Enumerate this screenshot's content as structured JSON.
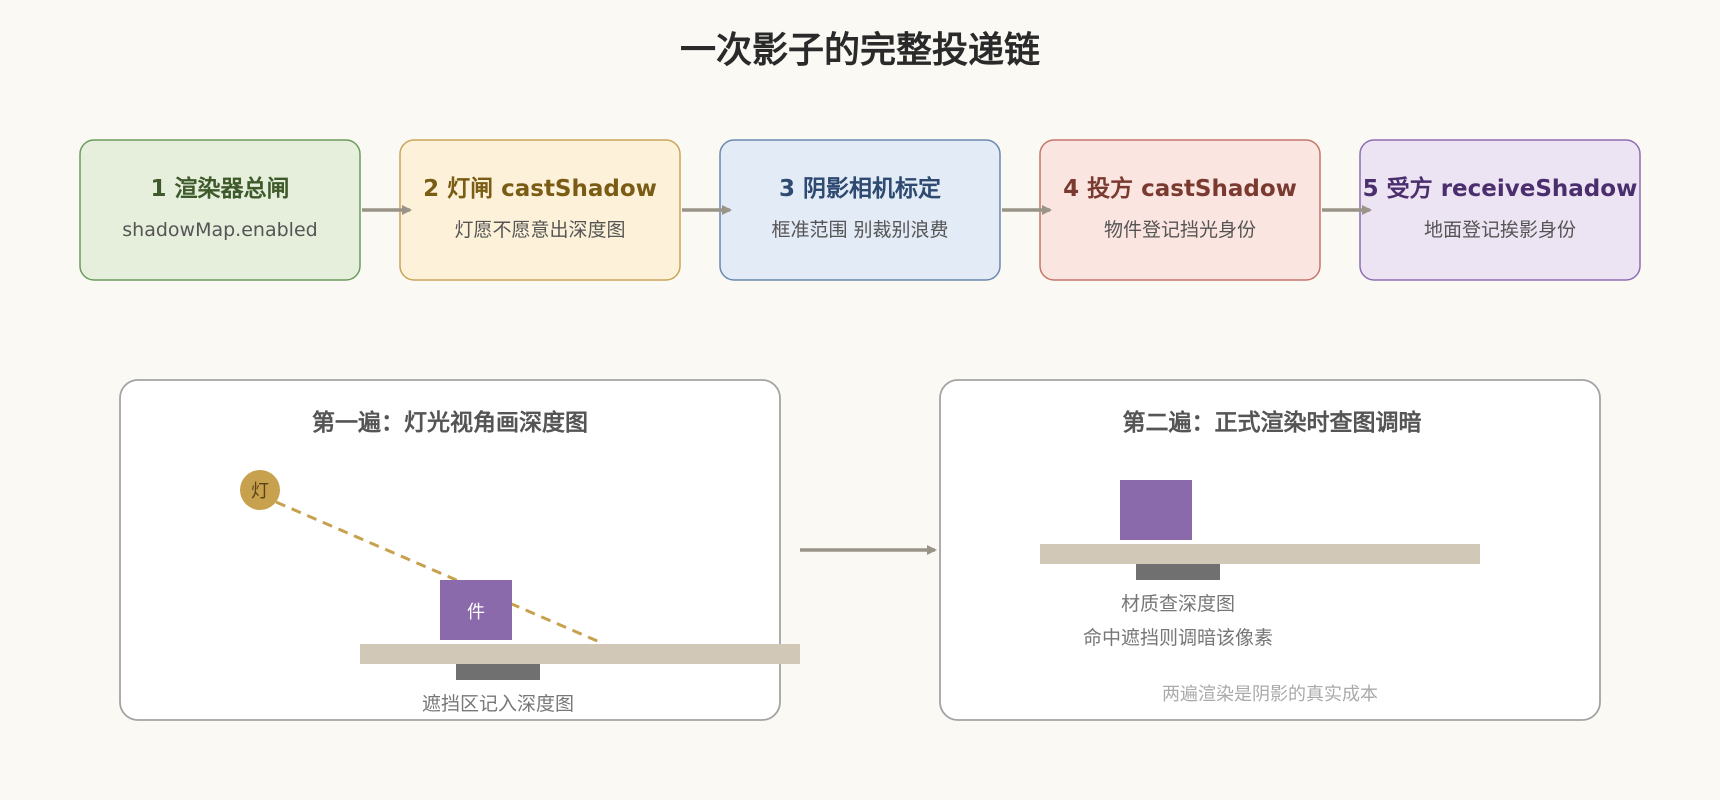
{
  "title": "一次影子的完整投递链",
  "steps": [
    {
      "title": "1 渲染器总闸",
      "subtitle": "shadowMap.enabled",
      "fill": "#e6efdc",
      "stroke": "#6a9a5c",
      "text_color": "#3e5a2a"
    },
    {
      "title": "2 灯闸 castShadow",
      "subtitle": "灯愿不愿意出深度图",
      "fill": "#fdf2d9",
      "stroke": "#c9a45a",
      "text_color": "#7a5c14"
    },
    {
      "title": "3 阴影相机标定",
      "subtitle": "框准范围 别裁别浪费",
      "fill": "#e2ebf6",
      "stroke": "#6b87ad",
      "text_color": "#2e4a70"
    },
    {
      "title": "4 投方 castShadow",
      "subtitle": "物件登记挡光身份",
      "fill": "#fbe5e0",
      "stroke": "#c4756a",
      "text_color": "#7a3a30"
    },
    {
      "title": "5 受方 receiveShadow",
      "subtitle": "地面登记挨影身份",
      "fill": "#ece3f3",
      "stroke": "#8e6cb2",
      "text_color": "#4a2e6e"
    }
  ],
  "panels": {
    "pass1": {
      "title": "第一遍：灯光视角画深度图",
      "light_label": "灯",
      "object_label": "件",
      "caption": "遮挡区记入深度图"
    },
    "pass2": {
      "title": "第二遍：正式渲染时查图调暗",
      "caption_line1": "材质查深度图",
      "caption_line2": "命中遮挡则调暗该像素",
      "footnote": "两遍渲染是阴影的真实成本"
    }
  },
  "colors": {
    "arrow": "#999487",
    "light": "#c8a14e",
    "object": "#8b6aab",
    "ground": "#d1c8b8",
    "shadow": "#707070",
    "panel_border": "#a3a3a3"
  }
}
